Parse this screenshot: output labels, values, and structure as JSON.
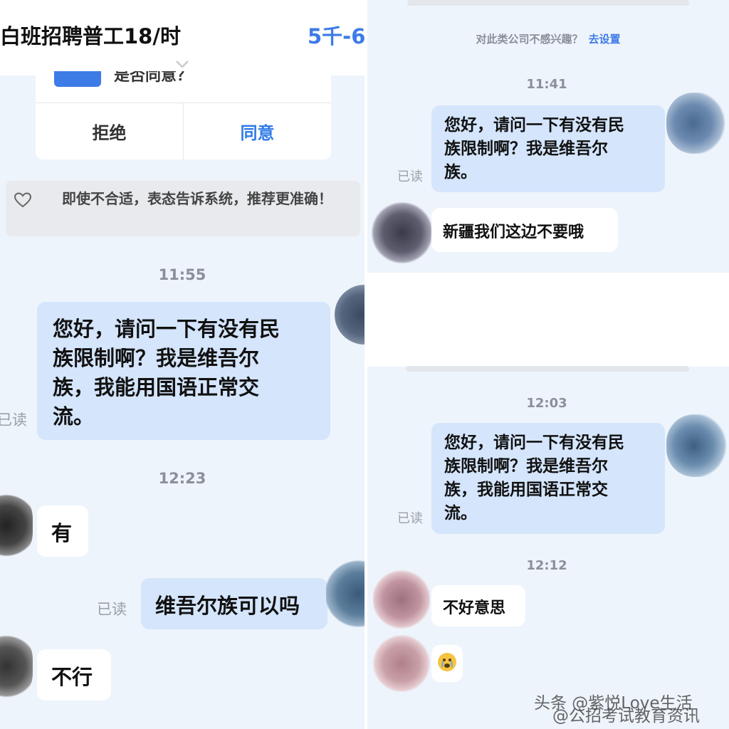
{
  "left": {
    "job_title": "白班招聘普工18/时",
    "salary": "5千-6",
    "card": {
      "cut_text": "是否同意？",
      "reject_label": "拒绝",
      "agree_label": "同意"
    },
    "tip": "即使不合适，表态告诉系统，推荐更准确！",
    "messages": {
      "ts1": "11:55",
      "m1": [
        "您好，请问一下有没有民",
        "族限制啊？我是维吾尔",
        "族，我能用国语正常交",
        "流。"
      ],
      "m1_status": "已读",
      "ts2": "12:23",
      "m2": "有",
      "m3": "维吾尔族可以吗",
      "m3_status": "已读",
      "m4": "不行"
    }
  },
  "right": {
    "notice": "对此类公司不感兴趣？",
    "notice_link": "去设置",
    "messages": {
      "ts1": "11:41",
      "m1": [
        "您好，请问一下有没有民",
        "族限制啊？我是维吾尔",
        "族。"
      ],
      "m1_status": "已读",
      "m2": "新疆我们这边不要哦",
      "ts2": "12:03",
      "m3": [
        "您好，请问一下有没有民",
        "族限制啊？我是维吾尔",
        "族，我能用国语正常交",
        "流。"
      ],
      "m3_status": "已读",
      "ts3": "12:12",
      "m4": "不好意思",
      "m5_icon": "crying-emoji"
    }
  },
  "watermark": {
    "line1": "头条 @紫悦Love生活",
    "line2": "@公招考试教育资讯"
  },
  "colors": {
    "accent": "#3d7be6",
    "sent_bubble": "#d4e5fc",
    "received_bubble": "#ffffff",
    "chat_background": "#eef4fb"
  }
}
